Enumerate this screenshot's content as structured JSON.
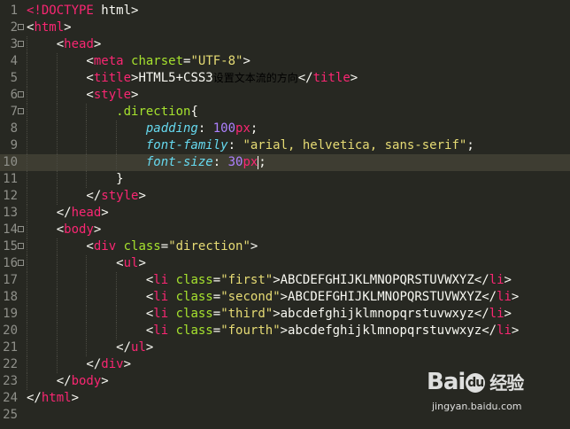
{
  "editor": {
    "lines": [
      {
        "n": "1",
        "fold": false,
        "tokens": [
          [
            "t",
            "<!DOCTYPE"
          ],
          [
            "p",
            " html>"
          ]
        ]
      },
      {
        "n": "2",
        "fold": true,
        "tokens": [
          [
            "p",
            "<"
          ],
          [
            "t",
            "html"
          ],
          [
            "p",
            ">"
          ]
        ]
      },
      {
        "n": "3",
        "fold": true,
        "tokens": [
          [
            "p",
            "    <"
          ],
          [
            "t",
            "head"
          ],
          [
            "p",
            ">"
          ]
        ]
      },
      {
        "n": "4",
        "fold": false,
        "tokens": [
          [
            "p",
            "        <"
          ],
          [
            "t",
            "meta"
          ],
          [
            "p",
            " "
          ],
          [
            "a",
            "charset"
          ],
          [
            "p",
            "="
          ],
          [
            "s",
            "\"UTF-8\""
          ],
          [
            "p",
            ">"
          ]
        ]
      },
      {
        "n": "5",
        "fold": false,
        "tokens": [
          [
            "p",
            "        <"
          ],
          [
            "t",
            "title"
          ],
          [
            "p",
            ">HTML5+CSS3"
          ],
          [
            "cjk",
            "设置文本流的方向"
          ],
          [
            "p",
            "</"
          ],
          [
            "t",
            "title"
          ],
          [
            "p",
            ">"
          ]
        ]
      },
      {
        "n": "6",
        "fold": true,
        "tokens": [
          [
            "p",
            "        <"
          ],
          [
            "t",
            "style"
          ],
          [
            "p",
            ">"
          ]
        ]
      },
      {
        "n": "7",
        "fold": true,
        "tokens": [
          [
            "p",
            "            "
          ],
          [
            "a",
            ".direction"
          ],
          [
            "p",
            "{"
          ]
        ]
      },
      {
        "n": "8",
        "fold": false,
        "tokens": [
          [
            "p",
            "                "
          ],
          [
            "k",
            "padding"
          ],
          [
            "p",
            ": "
          ],
          [
            "n",
            "100"
          ],
          [
            "u",
            "px"
          ],
          [
            "p",
            ";"
          ]
        ]
      },
      {
        "n": "9",
        "fold": false,
        "tokens": [
          [
            "p",
            "                "
          ],
          [
            "k",
            "font-family"
          ],
          [
            "p",
            ": "
          ],
          [
            "s",
            "\"arial, helvetica, sans-serif\""
          ],
          [
            "p",
            ";"
          ]
        ]
      },
      {
        "n": "10",
        "fold": false,
        "active": true,
        "tokens": [
          [
            "p",
            "                "
          ],
          [
            "k",
            "font-size"
          ],
          [
            "p",
            ": "
          ],
          [
            "n",
            "30"
          ],
          [
            "u",
            "px"
          ],
          [
            "caret",
            ""
          ],
          [
            "p",
            ";"
          ]
        ]
      },
      {
        "n": "11",
        "fold": false,
        "tokens": [
          [
            "p",
            "            }"
          ]
        ]
      },
      {
        "n": "12",
        "fold": false,
        "tokens": [
          [
            "p",
            "        </"
          ],
          [
            "t",
            "style"
          ],
          [
            "p",
            ">"
          ]
        ]
      },
      {
        "n": "13",
        "fold": false,
        "tokens": [
          [
            "p",
            "    </"
          ],
          [
            "t",
            "head"
          ],
          [
            "p",
            ">"
          ]
        ]
      },
      {
        "n": "14",
        "fold": true,
        "tokens": [
          [
            "p",
            "    <"
          ],
          [
            "t",
            "body"
          ],
          [
            "p",
            ">"
          ]
        ]
      },
      {
        "n": "15",
        "fold": true,
        "tokens": [
          [
            "p",
            "        <"
          ],
          [
            "t",
            "div"
          ],
          [
            "p",
            " "
          ],
          [
            "a",
            "class"
          ],
          [
            "p",
            "="
          ],
          [
            "s",
            "\"direction\""
          ],
          [
            "p",
            ">"
          ]
        ]
      },
      {
        "n": "16",
        "fold": true,
        "tokens": [
          [
            "p",
            "            <"
          ],
          [
            "t",
            "ul"
          ],
          [
            "p",
            ">"
          ]
        ]
      },
      {
        "n": "17",
        "fold": false,
        "tokens": [
          [
            "p",
            "                <"
          ],
          [
            "t",
            "li"
          ],
          [
            "p",
            " "
          ],
          [
            "a",
            "class"
          ],
          [
            "p",
            "="
          ],
          [
            "s",
            "\"first\""
          ],
          [
            "p",
            ">ABCDEFGHIJKLMNOPQRSTUVWXYZ</"
          ],
          [
            "t",
            "li"
          ],
          [
            "p",
            ">"
          ]
        ]
      },
      {
        "n": "18",
        "fold": false,
        "tokens": [
          [
            "p",
            "                <"
          ],
          [
            "t",
            "li"
          ],
          [
            "p",
            " "
          ],
          [
            "a",
            "class"
          ],
          [
            "p",
            "="
          ],
          [
            "s",
            "\"second\""
          ],
          [
            "p",
            ">ABCDEFGHIJKLMNOPQRSTUVWXYZ</"
          ],
          [
            "t",
            "li"
          ],
          [
            "p",
            ">"
          ]
        ]
      },
      {
        "n": "19",
        "fold": false,
        "tokens": [
          [
            "p",
            "                <"
          ],
          [
            "t",
            "li"
          ],
          [
            "p",
            " "
          ],
          [
            "a",
            "class"
          ],
          [
            "p",
            "="
          ],
          [
            "s",
            "\"third\""
          ],
          [
            "p",
            ">abcdefghijklmnopqrstuvwxyz</"
          ],
          [
            "t",
            "li"
          ],
          [
            "p",
            ">"
          ]
        ]
      },
      {
        "n": "20",
        "fold": false,
        "tokens": [
          [
            "p",
            "                <"
          ],
          [
            "t",
            "li"
          ],
          [
            "p",
            " "
          ],
          [
            "a",
            "class"
          ],
          [
            "p",
            "="
          ],
          [
            "s",
            "\"fourth\""
          ],
          [
            "p",
            ">abcdefghijklmnopqrstuvwxyz</"
          ],
          [
            "t",
            "li"
          ],
          [
            "p",
            ">"
          ]
        ]
      },
      {
        "n": "21",
        "fold": false,
        "tokens": [
          [
            "p",
            "            </"
          ],
          [
            "t",
            "ul"
          ],
          [
            "p",
            ">"
          ]
        ]
      },
      {
        "n": "22",
        "fold": false,
        "tokens": [
          [
            "p",
            "        </"
          ],
          [
            "t",
            "div"
          ],
          [
            "p",
            ">"
          ]
        ]
      },
      {
        "n": "23",
        "fold": false,
        "tokens": [
          [
            "p",
            "    </"
          ],
          [
            "t",
            "body"
          ],
          [
            "p",
            ">"
          ]
        ]
      },
      {
        "n": "24",
        "fold": false,
        "tokens": [
          [
            "p",
            "</"
          ],
          [
            "t",
            "html"
          ],
          [
            "p",
            ">"
          ]
        ]
      },
      {
        "n": "25",
        "fold": false,
        "tokens": []
      }
    ]
  },
  "colors": {
    "background": "#272822",
    "active_line": "#3e3d32",
    "tag": "#f92672",
    "attribute": "#a6e22e",
    "string": "#e6db74",
    "property": "#66d9ef",
    "number": "#ae81ff",
    "plain": "#f8f8f2",
    "gutter": "#8f908a"
  },
  "watermark": {
    "logo_a": "Bai",
    "logo_paw": "du",
    "logo_zh": "经验",
    "url": "jingyan.baidu.com"
  }
}
